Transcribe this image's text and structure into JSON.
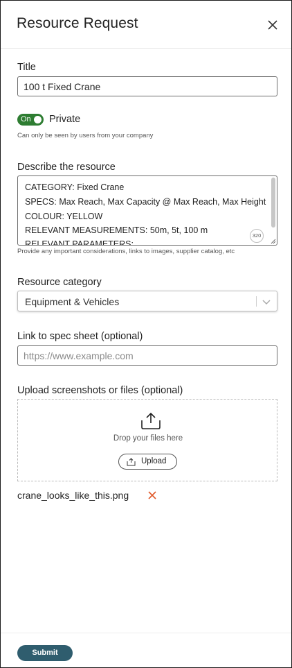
{
  "header": {
    "title": "Resource Request"
  },
  "title_field": {
    "label": "Title",
    "value": "100 t Fixed Crane"
  },
  "privacy": {
    "toggle_text": "On",
    "label": "Private",
    "helper": "Can only be seen by users from your company"
  },
  "description": {
    "label": "Describe the resource",
    "lines": [
      "CATEGORY: Fixed Crane",
      "SPECS: Max Reach, Max Capacity @ Max Reach, Max Height",
      "COLOUR: YELLOW",
      "RELEVANT MEASUREMENTS: 50m, 5t, 100 m",
      "RELEVANT PARAMETERS:"
    ],
    "char_count": "320",
    "helper": "Provide any important considerations, links to images, supplier catalog, etc"
  },
  "category": {
    "label": "Resource category",
    "selected": "Equipment & Vehicles"
  },
  "spec_link": {
    "label": "Link to spec sheet (optional)",
    "placeholder": "https://www.example.com",
    "value": ""
  },
  "upload": {
    "label": "Upload screenshots or files (optional)",
    "drop_text": "Drop your files here",
    "button_label": "Upload",
    "files": [
      {
        "name": "crane_looks_like_this.png"
      }
    ]
  },
  "footer": {
    "submit_label": "Submit"
  },
  "colors": {
    "toggle_on": "#2e7d32",
    "submit_bg": "#2f5d6e",
    "remove_icon": "#e05a2b",
    "input_border": "#6b6b6b"
  },
  "icons": {
    "close": "close-icon",
    "chevron": "chevron-down-icon",
    "upload": "upload-icon",
    "remove": "remove-file-icon"
  }
}
